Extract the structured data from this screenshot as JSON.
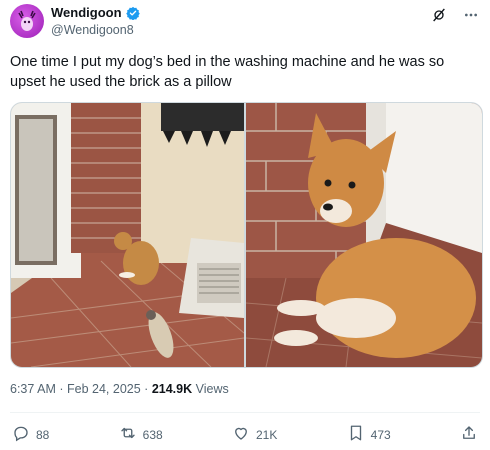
{
  "user": {
    "display_name": "Wendigoon",
    "handle": "@Wendigoon8"
  },
  "tweet": {
    "text": "One time I put my dog’s bed in the washing machine and he was so upset he used the brick as a pillow",
    "time": "6:37 AM",
    "separator": "·",
    "date": "Feb 24, 2025",
    "views_count": "214.9K",
    "views_label": "Views"
  },
  "actions": {
    "replies": "88",
    "reposts": "638",
    "likes": "21K",
    "bookmarks": "473"
  },
  "colors": {
    "verified": "#1d9bf0",
    "muted_text": "#536471",
    "avatar": "#c04ad6"
  },
  "icons": [
    "grok-icon",
    "more-icon",
    "verified-badge-icon",
    "reply-icon",
    "repost-icon",
    "like-icon",
    "bookmark-icon",
    "share-icon"
  ]
}
